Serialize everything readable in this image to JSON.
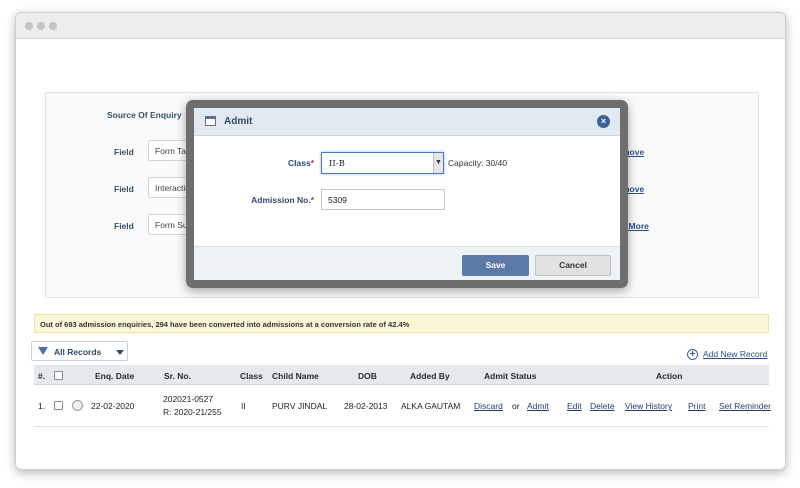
{
  "source_panel": {
    "heading": "Source Of Enquiry",
    "rows": [
      {
        "label": "Field",
        "value": "Form Tak",
        "link": "move"
      },
      {
        "label": "Field",
        "value": "Interactio",
        "link": "move"
      },
      {
        "label": "Field",
        "value": "Form Sul",
        "link": "d More"
      }
    ]
  },
  "modal": {
    "title": "Admit",
    "class_label": "Class",
    "class_value": "II-B",
    "capacity": "Capacity: 30/40",
    "admission_label": "Admission No.",
    "admission_value": "5309",
    "required_mark": "*",
    "save": "Save",
    "cancel": "Cancel",
    "close_glyph": "×"
  },
  "banner": "Out of 693 admission enquiries, 294 have been converted into admissions at a conversion rate of 42.4%",
  "toolbar": {
    "filter_label": "All Records",
    "add_new": "Add New Record",
    "add_glyph": "+"
  },
  "table": {
    "columns": [
      "#.",
      "Enq. Date",
      "Sr. No.",
      "Class",
      "Child Name",
      "DOB",
      "Added By",
      "Admit Status",
      "Action"
    ],
    "rows": [
      {
        "num": "1.",
        "enq_date": "22-02-2020",
        "sr_no_1": "202021-0527",
        "sr_no_2": "R: 2020-21/255",
        "class": "II",
        "child_name": "PURV JINDAL",
        "dob": "28-02-2013",
        "added_by": "ALKA GAUTAM",
        "discard": "Discard",
        "or": "or",
        "admit": "Admit",
        "actions": [
          "Edit",
          "Delete",
          "View History",
          "Print",
          "Set Reminder"
        ]
      }
    ]
  }
}
